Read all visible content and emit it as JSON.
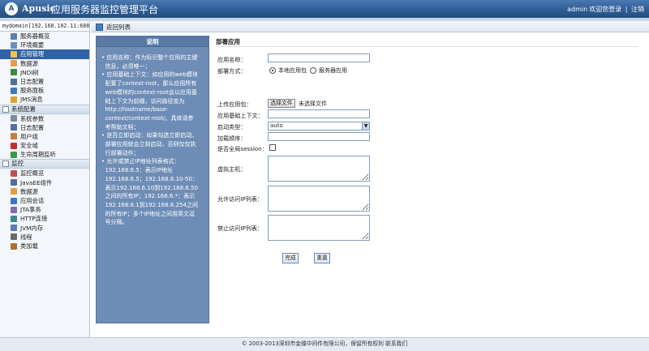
{
  "header": {
    "logo_letter": "A",
    "brand": "Apusic",
    "product": "应用服务器监控管理平台",
    "user": "admin",
    "welcome": "欢迎您登录",
    "divider": "|",
    "logout": "注销"
  },
  "sidebar": {
    "domain": "mydomain[192.168.102.11:6888]",
    "groups": [
      {
        "title": "",
        "items": [
          {
            "label": "服务器概览",
            "icon": "server-overview-icon",
            "color": "#5a7fb0"
          },
          {
            "label": "环境概要",
            "icon": "environment-icon",
            "color": "#6c8fbc"
          },
          {
            "label": "应用管理",
            "icon": "application-icon",
            "color": "#f2c14e",
            "active": true
          },
          {
            "label": "数据源",
            "icon": "datasource-icon",
            "color": "#e0a040"
          },
          {
            "label": "JNDI树",
            "icon": "jndi-tree-icon",
            "color": "#3a8a3a"
          },
          {
            "label": "日志配置",
            "icon": "log-config-icon",
            "color": "#4f6f9f"
          },
          {
            "label": "服务面板",
            "icon": "service-panel-icon",
            "color": "#3c78c4"
          },
          {
            "label": "JMS消息",
            "icon": "jms-icon",
            "color": "#e0a030"
          }
        ]
      },
      {
        "title": "系统配置",
        "items": [
          {
            "label": "系统参数",
            "icon": "system-params-icon",
            "color": "#7a8aa0"
          },
          {
            "label": "日志配置",
            "icon": "log-config-icon",
            "color": "#4f6f9f"
          },
          {
            "label": "用户组",
            "icon": "user-group-icon",
            "color": "#c08040"
          },
          {
            "label": "安全域",
            "icon": "security-domain-icon",
            "color": "#c03030"
          },
          {
            "label": "生命周期监听",
            "icon": "lifecycle-icon",
            "color": "#3a9a4a"
          }
        ]
      },
      {
        "title": "监控",
        "items": [
          {
            "label": "监控概览",
            "icon": "monitor-overview-icon",
            "color": "#c05050"
          },
          {
            "label": "JavaEE组件",
            "icon": "javaee-icon",
            "color": "#5070a0"
          },
          {
            "label": "数据源",
            "icon": "datasource-icon",
            "color": "#e0a040"
          },
          {
            "label": "应用会话",
            "icon": "session-icon",
            "color": "#3c78c4"
          },
          {
            "label": "JTA事务",
            "icon": "jta-icon",
            "color": "#8a6ab0"
          },
          {
            "label": "HTTP连接",
            "icon": "http-icon",
            "color": "#3a8a8a"
          },
          {
            "label": "JVM内存",
            "icon": "jvm-memory-icon",
            "color": "#5a7fb0"
          },
          {
            "label": "线程",
            "icon": "thread-icon",
            "color": "#6a6a6a"
          },
          {
            "label": "类加载",
            "icon": "class-loading-icon",
            "color": "#b07030"
          }
        ]
      }
    ]
  },
  "content": {
    "back_link": "返回列表",
    "help": {
      "title": "说明",
      "lines": [
        "• 应用名称：作为标识整个应用的主键",
        "  信息，必须唯一；",
        "• 应用基础上下文：如应用的web模块",
        "  配置了context-root，那么应用所有",
        "  web模块的context-root会以应用基",
        "  础上下文为前缀，访问路径变为",
        "  http://hostname/base-",
        "  context/context-root/。具体请参",
        "  考帮助文档；",
        "• 是否立即启动：如果勾选立即启动，",
        "  部署应用就会立刻启动，否则仅仅执",
        "  行部署动作；",
        "• 允许或禁止IP地址列表格式：",
        "  192.168.6.5：表示IP地址",
        "  192.168.6.5；192.168.6.10-50：",
        "  表示192.168.6.10到192.168.6.50",
        "  之间的所有IP；192.168.6.*：表示",
        "  192.168.6.1到192.168.6.254之间",
        "  的所有IP；多个IP地址之间用英文逗",
        "  号分隔。"
      ]
    },
    "form": {
      "title": "部署应用",
      "app_name_label": "应用名称：",
      "app_name_value": "",
      "deploy_mode_label": "部署方式：",
      "deploy_local": "本地应用包",
      "deploy_server": "服务器应用",
      "upload_label": "上传应用包：",
      "file_button": "选择文件",
      "file_status": "未选择文件",
      "base_context_label": "应用基础上下文：",
      "base_context_value": "",
      "start_type_label": "启动类型：",
      "start_type_value": "auto",
      "load_order_label": "加载顺序：",
      "load_order_value": "",
      "global_session_label": "是否全局session：",
      "virtual_host_label": "虚拟主机：",
      "allow_ip_label": "允许访问IP列表：",
      "deny_ip_label": "禁止访问IP列表：",
      "submit": "完成",
      "reset": "重置"
    }
  },
  "footer": {
    "copyright": "© 2003-2013深圳市金蝶中间件有限公司，保留所有权利 联系我们"
  }
}
